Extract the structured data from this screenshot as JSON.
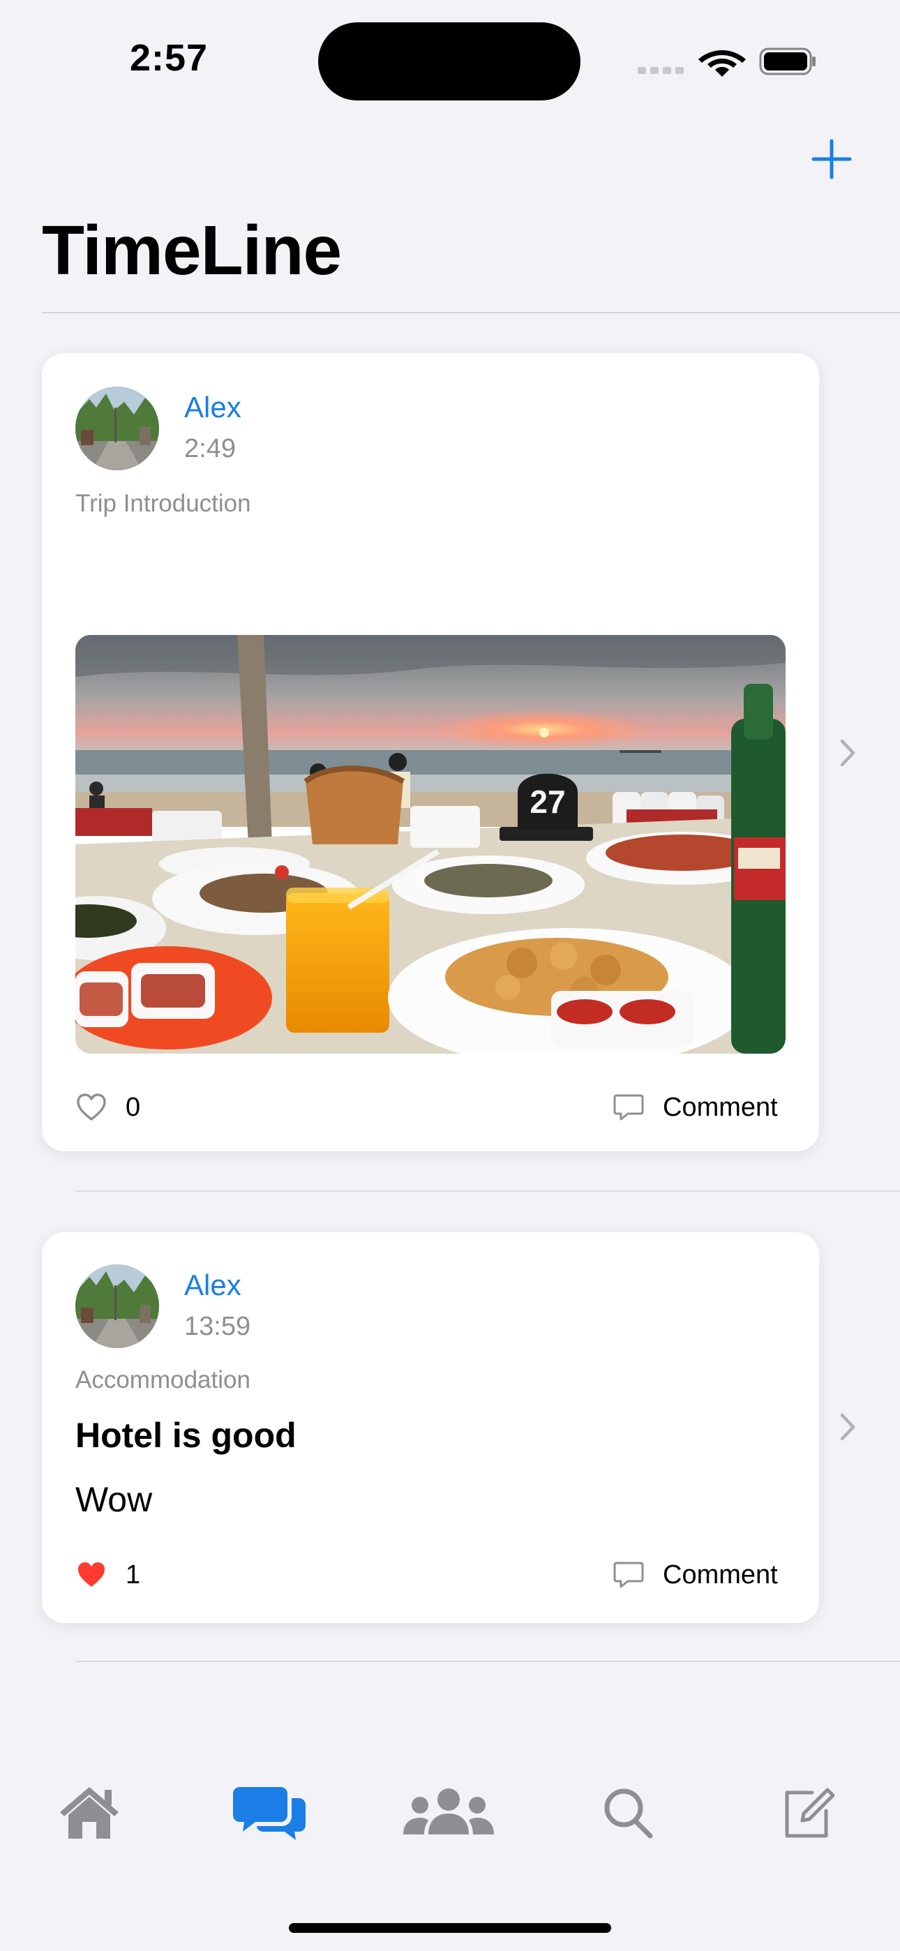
{
  "status_bar": {
    "time": "2:57"
  },
  "nav": {
    "title": "TimeLine",
    "add_icon": "plus-icon"
  },
  "posts": [
    {
      "author": "Alex",
      "time": "2:49",
      "category": "Trip Introduction",
      "title": "",
      "body": "",
      "has_photo": true,
      "liked": false,
      "likes": "0",
      "comment_label": "Comment"
    },
    {
      "author": "Alex",
      "time": "13:59",
      "category": "Accommodation",
      "title": "Hotel is good",
      "body": "Wow",
      "has_photo": false,
      "liked": true,
      "likes": "1",
      "comment_label": "Comment"
    }
  ],
  "photo_text": {
    "table_number": "27"
  },
  "tab_bar": {
    "items": [
      {
        "icon": "house-icon",
        "selected": false
      },
      {
        "icon": "chat-bubbles-icon",
        "selected": true
      },
      {
        "icon": "people-icon",
        "selected": false
      },
      {
        "icon": "search-icon",
        "selected": false
      },
      {
        "icon": "compose-icon",
        "selected": false
      }
    ]
  },
  "colors": {
    "accent": "#1a7ee6",
    "tab_inactive": "#8e8e93",
    "like_active": "#ff3b30",
    "background": "#f2f2f7",
    "card": "#ffffff"
  }
}
